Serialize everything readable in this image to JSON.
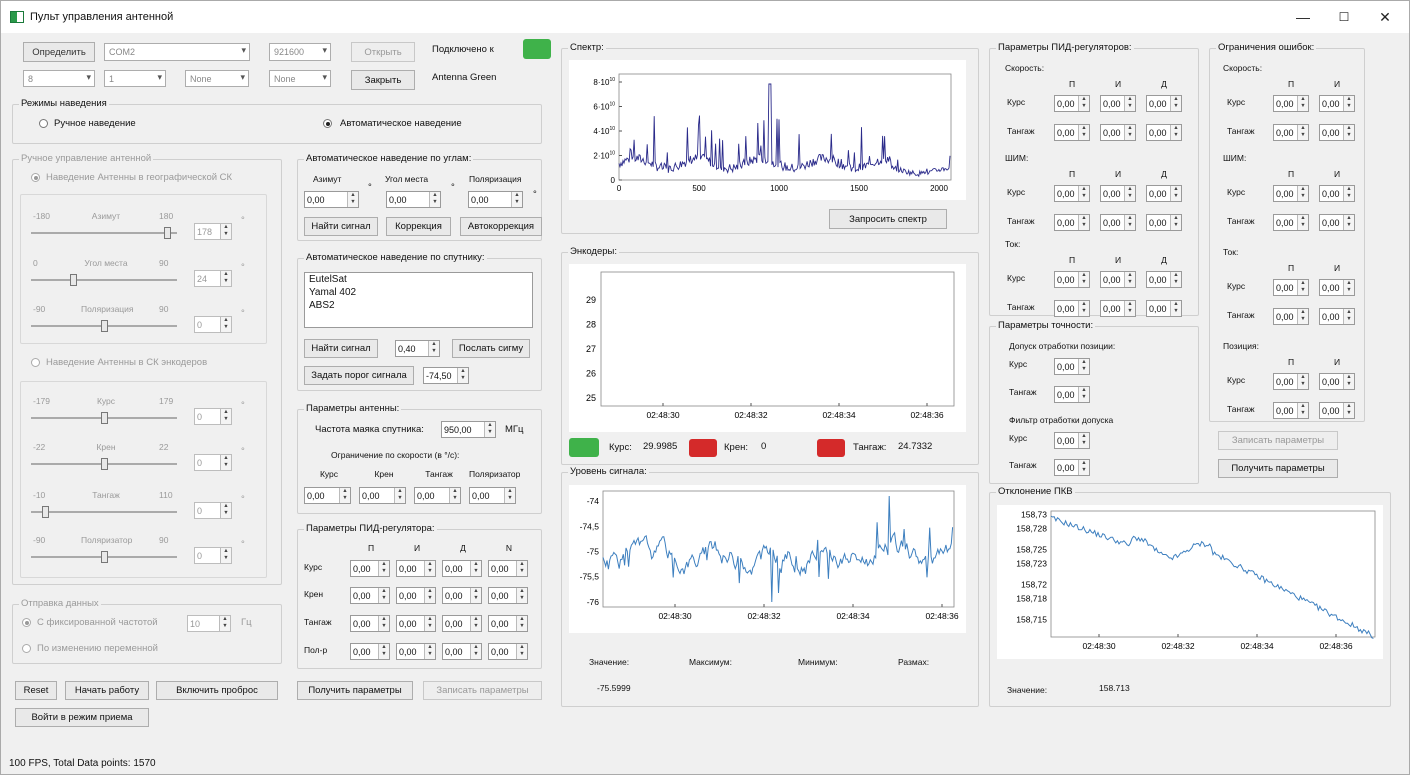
{
  "window": {
    "title": "Пульт управления антенной",
    "min": "—",
    "max": "☐",
    "close": "✕"
  },
  "conn": {
    "detect": "Определить",
    "port": "COM2",
    "baud": "921600",
    "open": "Открыть",
    "close": "Закрыть",
    "connected": "Подключено к",
    "device": "Antenna Green",
    "c1": "8",
    "c2": "1",
    "c3": "None",
    "c4": "None",
    "led_color": "#3fb24a"
  },
  "modes": {
    "title": "Режимы наведения",
    "manual": "Ручное наведение",
    "auto": "Автоматическое наведение"
  },
  "manual": {
    "title": "Ручное управление антенной",
    "geo": "Наведение Антенны в географической СК",
    "enc": "Наведение Антенны в СК энкодеров",
    "deg": "°",
    "az": {
      "min": "-180",
      "label": "Азимут",
      "max": "180",
      "val": "178"
    },
    "el": {
      "min": "0",
      "label": "Угол места",
      "max": "90",
      "val": "24"
    },
    "pol": {
      "min": "-90",
      "label": "Поляризация",
      "max": "90",
      "val": "0"
    },
    "kurs": {
      "min": "-179",
      "label": "Курс",
      "max": "179",
      "val": "0"
    },
    "kren": {
      "min": "-22",
      "label": "Крен",
      "max": "22",
      "val": "0"
    },
    "tang": {
      "min": "-10",
      "label": "Тангаж",
      "max": "110",
      "val": "0"
    },
    "polr": {
      "min": "-90",
      "label": "Поляризатор",
      "max": "90",
      "val": "0"
    }
  },
  "send": {
    "title": "Отправка данных",
    "fixed": "С фиксированной частотой",
    "freq": "10",
    "unit": "Гц",
    "onchange": "По изменению переменной"
  },
  "bottom": {
    "reset": "Reset",
    "start": "Начать работу",
    "forward": "Включить проброс",
    "recv": "Войти в режим приема",
    "status": "100 FPS, Total Data points: 1570"
  },
  "auto_angles": {
    "title": "Автоматическое наведение по углам:",
    "az": "Азимут",
    "el": "Угол места",
    "pol": "Поляризация",
    "v1": "0,00",
    "v2": "0,00",
    "v3": "0,00",
    "deg": "°",
    "find": "Найти сигнал",
    "corr": "Коррекция",
    "autocorr": "Автокоррекция"
  },
  "auto_sat": {
    "title": "Автоматическое наведение по спутнику:",
    "sats": [
      "EutelSat",
      "Yamal 402",
      "ABS2"
    ],
    "find": "Найти сигнал",
    "val": "0,40",
    "send": "Послать сигму",
    "threshold": "Задать порог сигнала",
    "thrval": "-74,50"
  },
  "antenna": {
    "title": "Параметры антенны:",
    "freq_label": "Частота маяка спутника:",
    "freq": "950,00",
    "unit": "МГц",
    "limit": "Ограничение по скорости (в °/с):",
    "cols": [
      "Курс",
      "Крен",
      "Тангаж",
      "Поляризатор"
    ],
    "vals": [
      "0,00",
      "0,00",
      "0,00",
      "0,00"
    ]
  },
  "pid_small": {
    "title": "Параметры ПИД-регулятора:",
    "cols": [
      "П",
      "И",
      "Д",
      "N"
    ],
    "rows": [
      "Курс",
      "Крен",
      "Тангаж",
      "Пол-р"
    ],
    "val": "0,00"
  },
  "params_btns": {
    "get": "Получить параметры",
    "write": "Записать параметры"
  },
  "spectrum": {
    "title": "Спектр:",
    "button": "Запросить спектр",
    "yticks": [
      "8·10",
      "6·10",
      "4·10",
      "2·10",
      "0"
    ],
    "sup": "10",
    "xticks": [
      "0",
      "500",
      "1000",
      "1500",
      "2000"
    ]
  },
  "encoders": {
    "title": "Энкодеры:",
    "yticks": [
      "29",
      "28",
      "27",
      "26",
      "25"
    ],
    "xticks": [
      "02:48:30",
      "02:48:32",
      "02:48:34",
      "02:48:36"
    ],
    "kurs_label": "Курс:",
    "kurs": "29.9985",
    "kren_label": "Крен:",
    "kren": "0",
    "tang_label": "Тангаж:",
    "tang": "24.7332",
    "green": "#3fb24a",
    "red": "#d42a2a"
  },
  "signal": {
    "title": "Уровень сигнала:",
    "yticks": [
      "-74",
      "-74,5",
      "-75",
      "-75,5",
      "-76"
    ],
    "xticks": [
      "02:48:30",
      "02:48:32",
      "02:48:34",
      "02:48:36"
    ],
    "value_label": "Значение:",
    "max_label": "Максимум:",
    "min_label": "Минимум:",
    "range_label": "Размах:",
    "value": "-75.5999"
  },
  "pid_big": {
    "title": "Параметры ПИД-регуляторов:",
    "speed": "Скорость:",
    "shim": "ШИМ:",
    "tok": "Ток:",
    "cols": [
      "П",
      "И",
      "Д"
    ],
    "kurs": "Курс",
    "tang": "Тангаж",
    "val": "0,00"
  },
  "precision": {
    "title": "Параметры точности:",
    "pos": "Допуск отработки позиции:",
    "filter": "Фильтр отработки допуска",
    "kurs": "Курс",
    "tang": "Тангаж",
    "val": "0,00"
  },
  "errors": {
    "title": "Ограничения ошибок:",
    "speed": "Скорость:",
    "shim": "ШИМ:",
    "tok": "Ток:",
    "pos": "Позиция:",
    "cols": [
      "П",
      "И"
    ],
    "kurs": "Курс",
    "tang": "Тангаж",
    "val": "0,00",
    "write": "Записать параметры",
    "get": "Получить параметры"
  },
  "pkv": {
    "title": "Отклонение ПКВ",
    "yticks": [
      "158,73",
      "158,728",
      "158,725",
      "158,723",
      "158,72",
      "158,718",
      "158,715"
    ],
    "xticks": [
      "02:48:30",
      "02:48:32",
      "02:48:34",
      "02:48:36"
    ],
    "value_label": "Значение:",
    "value": "158.713"
  }
}
